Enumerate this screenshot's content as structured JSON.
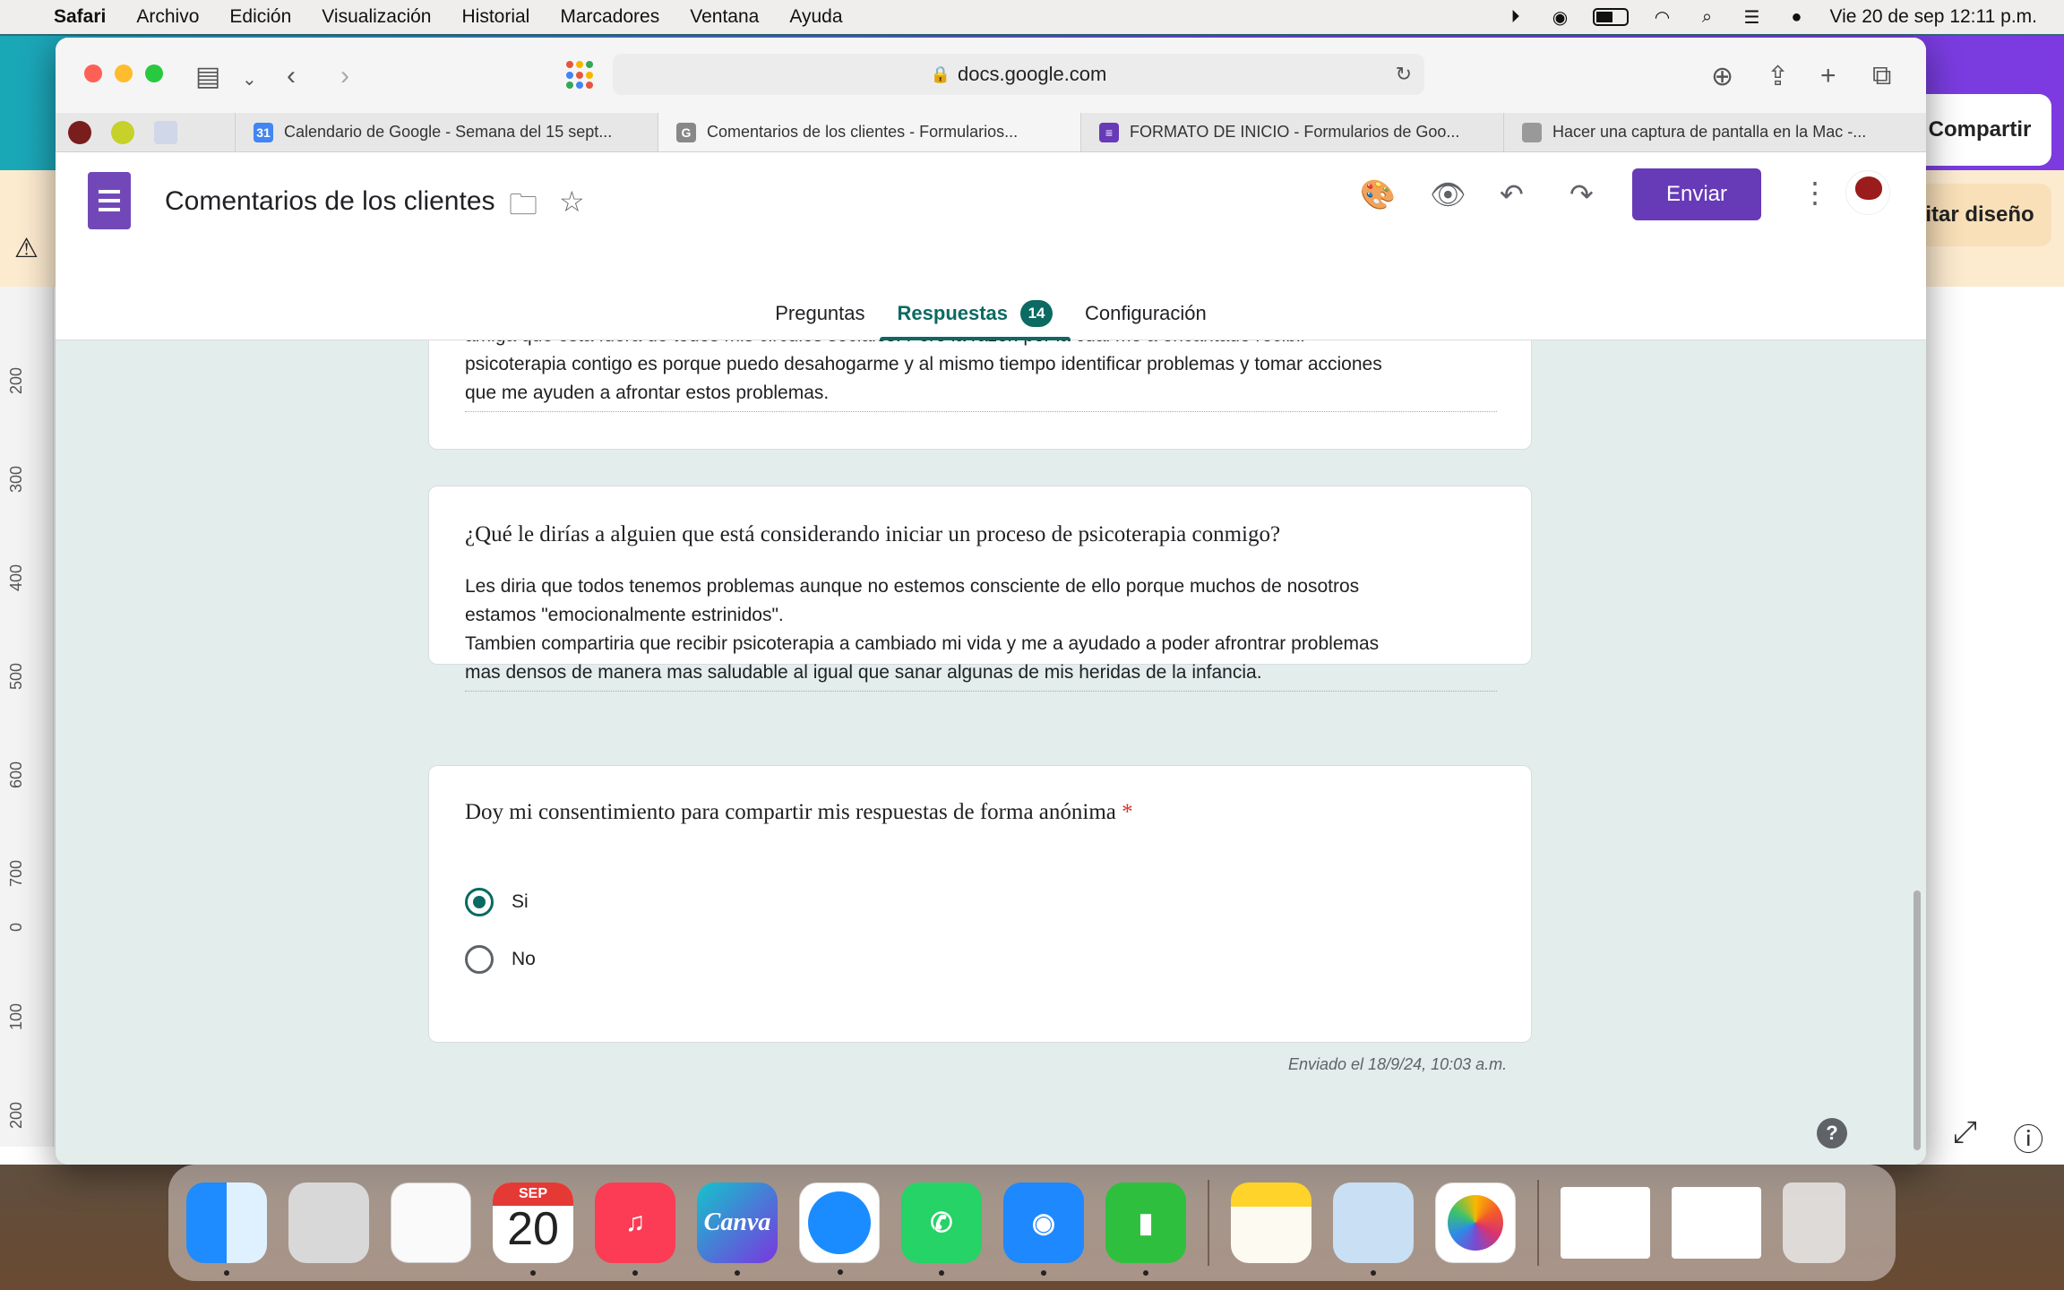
{
  "menubar": {
    "app": "Safari",
    "items": [
      "Archivo",
      "Edición",
      "Visualización",
      "Historial",
      "Marcadores",
      "Ventana",
      "Ayuda"
    ],
    "clock": "Vie 20 de sep  12:11 p.m."
  },
  "browser": {
    "address": "docs.google.com",
    "tabs": [
      {
        "title": "Calendario de Google - Semana del 15 sept...",
        "favicon": "calendar-icon"
      },
      {
        "title": "Comentarios de los clientes - Formularios...",
        "favicon": "google-icon"
      },
      {
        "title": "FORMATO DE INICIO - Formularios de Goo...",
        "favicon": "forms-icon"
      },
      {
        "title": "Hacer una captura de pantalla en la Mac -...",
        "favicon": "apple-icon"
      }
    ]
  },
  "background_app": {
    "share_label": "Compartir",
    "edit_label": "itar diseño",
    "ruler_marks": [
      "200",
      "300",
      "400",
      "500",
      "600",
      "700",
      "0",
      "100",
      "200"
    ]
  },
  "form": {
    "title": "Comentarios de los clientes",
    "send_label": "Enviar",
    "tabs": {
      "questions": "Preguntas",
      "responses": "Respuestas",
      "responses_count": "14",
      "settings": "Configuración"
    },
    "card1": {
      "answer_line1": "amiga que esta fuera de todos mis circulos sociales. Pero la razon por la cual me a encantado recibir",
      "answer_line2": "psicoterapia contigo es porque puedo desahogarme y al mismo tiempo identificar problemas y tomar acciones",
      "answer_line3": "que me ayuden a afrontar estos problemas."
    },
    "card2": {
      "question": "¿Qué le dirías a alguien que está considerando iniciar un proceso de psicoterapia conmigo?",
      "answer_line1": "Les diria que todos tenemos problemas aunque no estemos consciente de ello porque muchos de nosotros",
      "answer_line2": "estamos \"emocionalmente estrinidos\".",
      "answer_line3": "Tambien compartiria que recibir psicoterapia a cambiado mi vida y me a ayudado a poder afrontrar problemas",
      "answer_line4": "mas densos de manera mas saludable al igual que sanar algunas de mis heridas de la infancia."
    },
    "card3": {
      "question": "Doy mi consentimiento para compartir mis respuestas de forma anónima",
      "required_mark": "*",
      "options": [
        "Si",
        "No"
      ],
      "selected": "Si"
    },
    "submitted": "Enviado el 18/9/24, 10:03 a.m."
  },
  "dock": {
    "calendar_month": "SEP",
    "calendar_day": "20",
    "canva_label": "Canva"
  },
  "colors": {
    "forms_purple": "#673ab7",
    "forms_teal": "#0b6a62",
    "content_bg": "#e2edec"
  }
}
